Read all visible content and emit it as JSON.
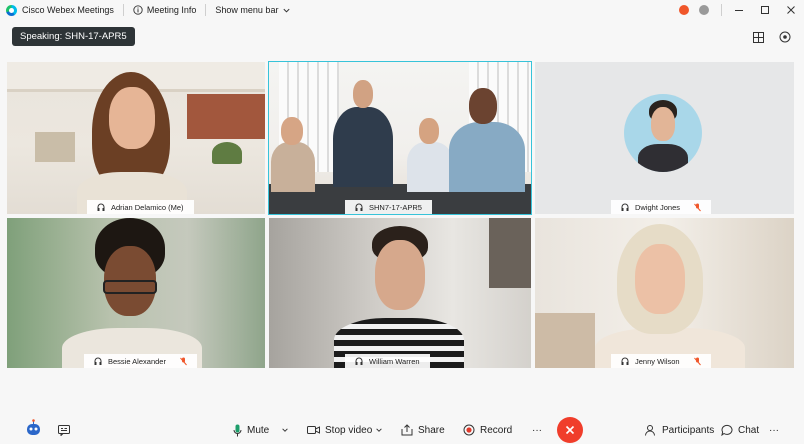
{
  "titlebar": {
    "app_name": "Cisco Webex Meetings",
    "meeting_info": "Meeting Info",
    "show_menu_bar": "Show menu bar"
  },
  "speaking_label": "Speaking: SHN-17-APR5",
  "participants": [
    {
      "name": "Adrian Delamico (Me)",
      "muted": false
    },
    {
      "name": "SHN7-17-APR5",
      "muted": false,
      "active": true
    },
    {
      "name": "Dwight Jones",
      "muted": true
    },
    {
      "name": "Bessie Alexander",
      "muted": true
    },
    {
      "name": "William Warren",
      "muted": false
    },
    {
      "name": "Jenny Wilson",
      "muted": true
    }
  ],
  "controls": {
    "mute": "Mute",
    "stop_video": "Stop video",
    "share": "Share",
    "record": "Record",
    "more": "···",
    "participants": "Participants",
    "chat": "Chat",
    "more_right": "···"
  },
  "colors": {
    "active_border": "#37c3d9",
    "end_call": "#f03d2b",
    "speaking_bg": "#2e3437",
    "muted_icon": "#f0562a"
  }
}
